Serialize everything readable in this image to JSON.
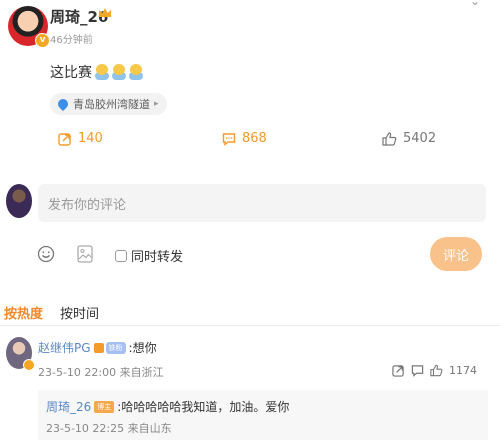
{
  "post": {
    "username": "周琦_26",
    "time": "46分钟前",
    "text": "这比赛",
    "emojis": [
      "pray-emoji",
      "pray-emoji",
      "pray-emoji"
    ],
    "location": "青岛胶州湾隧道",
    "stats": {
      "repost_count": "140",
      "comment_count": "868",
      "like_count": "5402"
    }
  },
  "composer": {
    "placeholder": "发布你的评论",
    "forward_label": "同时转发",
    "send_label": "评论"
  },
  "sort": {
    "hot_label": "按热度",
    "time_label": "按时间"
  },
  "comments": [
    {
      "author": "赵继伟PG",
      "fan_badge": "铁粉",
      "text": ":想你",
      "meta": "23-5-10 22:00 来自浙江",
      "like_count": "1174",
      "reply": {
        "author": "周琦_26",
        "author_badge": "博主",
        "text": ":哈哈哈哈哈我知道，加油。爱你",
        "meta": "23-5-10 22:25 来自山东"
      }
    }
  ],
  "colors": {
    "accent_orange": "#f39b2a",
    "link_blue": "#5a88c6",
    "send_button_bg": "#f9c28a"
  }
}
